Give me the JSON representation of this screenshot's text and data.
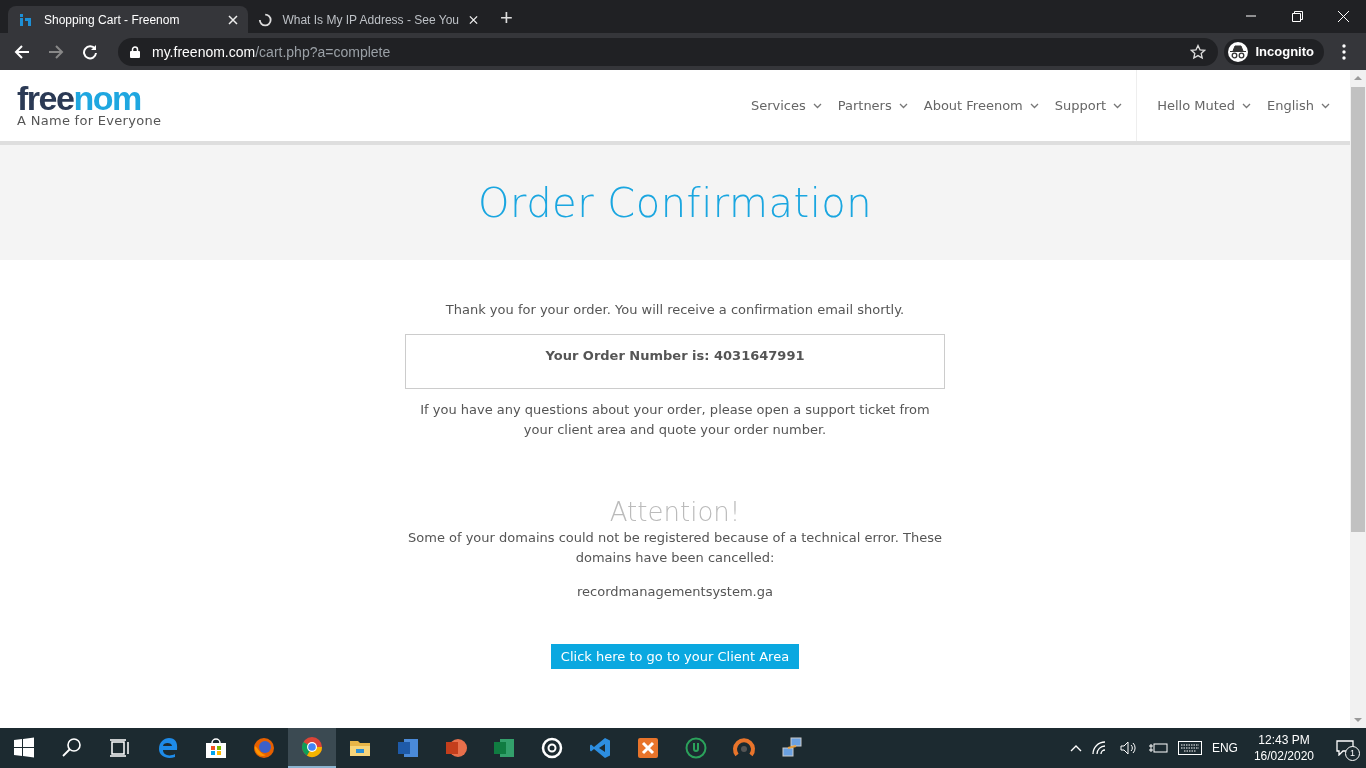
{
  "browser": {
    "tabs": [
      {
        "title": "Shopping Cart - Freenom",
        "kind": "site",
        "selected": true
      },
      {
        "title": "What Is My IP Address - See You",
        "kind": "loading",
        "selected": false
      }
    ],
    "new_tab": "+",
    "address": {
      "host": "my.freenom.com",
      "path": "/cart.php?a=complete"
    },
    "profile": "Incognito"
  },
  "site": {
    "logo": {
      "part_1": "free",
      "part_2": "nom",
      "tagline": "A Name for Everyone"
    },
    "nav": [
      "Services",
      "Partners",
      "About Freenom",
      "Support"
    ],
    "account_nav": [
      "Hello Muted",
      "English"
    ]
  },
  "page": {
    "title": "Order Confirmation",
    "thanks": "Thank you for your order. You will receive a confirmation email shortly.",
    "order_number": "Your Order Number is: 4031647991",
    "questions": "If you have any questions about your order, please open a support ticket from your client area and quote your order number.",
    "attention_title": "Attention!",
    "attention_text": "Some of your domains could not be registered because of a technical error. These domains have been cancelled:",
    "domains": [
      "recordmanagementsystem.ga"
    ],
    "button": "Click here to go to your Client Area"
  },
  "taskbar": {
    "apps": [
      {
        "kind": "start",
        "selected": false
      },
      {
        "kind": "search",
        "selected": false
      },
      {
        "kind": "taskview",
        "selected": false
      },
      {
        "kind": "edge",
        "selected": false
      },
      {
        "kind": "store",
        "selected": false
      },
      {
        "kind": "firefox",
        "selected": false
      },
      {
        "kind": "chrome",
        "selected": true
      },
      {
        "kind": "folder",
        "selected": false
      },
      {
        "kind": "word",
        "selected": false
      },
      {
        "kind": "powerpoint",
        "selected": false
      },
      {
        "kind": "excel",
        "selected": false
      },
      {
        "kind": "ring",
        "selected": false
      },
      {
        "kind": "vscode",
        "selected": false
      },
      {
        "kind": "xampp",
        "selected": false
      },
      {
        "kind": "green-circle",
        "selected": false
      },
      {
        "kind": "orange-ring",
        "selected": false
      },
      {
        "kind": "network-pcs",
        "selected": false
      }
    ],
    "language": "ENG",
    "time": "12:43 PM",
    "date": "16/02/2020",
    "notifications": "1"
  }
}
